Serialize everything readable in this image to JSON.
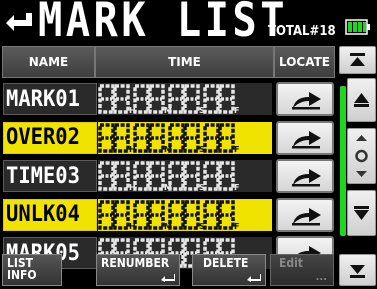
{
  "header": {
    "title": "MARK LIST",
    "total": "TOTAL#18",
    "battery_color": "#1ed81e"
  },
  "columns": {
    "name": "NAME",
    "time": "TIME",
    "locate": "LOCATE"
  },
  "marks": [
    {
      "name": "MARK01",
      "highlighted": false
    },
    {
      "name": "OVER02",
      "highlighted": true
    },
    {
      "name": "TIME03",
      "highlighted": false
    },
    {
      "name": "UNLK04",
      "highlighted": true
    },
    {
      "name": "MARK05",
      "highlighted": false
    }
  ],
  "time_unit_labels": [
    "H",
    "M",
    "S",
    "F"
  ],
  "footer": {
    "list_info": "LIST\nINFO",
    "renumber": "RENUMBER",
    "delete": "DELETE",
    "edit": "Edit"
  },
  "icons": {
    "back": "return-arrow-icon",
    "locate": "locate-arrow-icon",
    "scroll_top": "scroll-top-icon",
    "scroll_up": "scroll-up-icon",
    "scroll_thumb": "scroll-thumb-icon",
    "scroll_down": "scroll-down-icon",
    "scroll_bottom": "scroll-bottom-icon"
  },
  "colors": {
    "highlight": "#f0e300",
    "normal_row": "#2a2a2a",
    "scroll_track": "#1ed81e"
  }
}
